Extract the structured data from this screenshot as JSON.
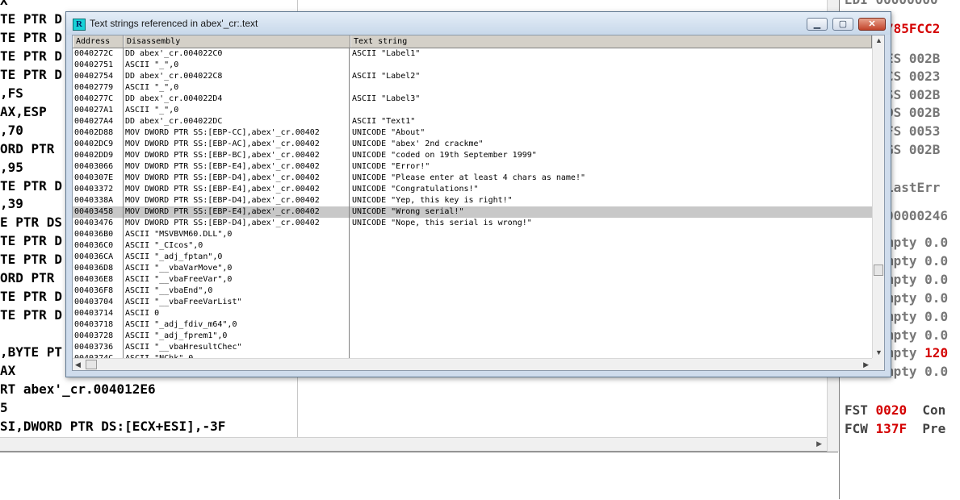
{
  "background": {
    "disasm_lines": [
      "X",
      "TE PTR D",
      "TE PTR D",
      "TE PTR D",
      "TE PTR D",
      ",FS",
      "AX,ESP",
      ",70",
      "ORD PTR",
      ",95",
      "TE PTR D",
      ",39",
      "E PTR DS",
      "TE PTR D",
      "TE PTR D",
      "ORD PTR",
      "TE PTR D",
      "TE PTR D",
      "",
      ",BYTE PT",
      "AX",
      "RT abex'_cr.004012E6",
      "5",
      "SI,DWORD PTR DS:[ECX+ESI],-3F"
    ],
    "registers": {
      "edi": "EDI 00000000",
      "eip_tail": "785FCC2",
      "es": "ES 002B",
      "cs": "CS 0023",
      "ss": "SS 002B",
      "ds": "DS 002B",
      "fs": "FS 0053",
      "gs": "GS 002B",
      "lasterr": "LastErr",
      "efl": "00000246",
      "fpu": [
        {
          "prefix": "mpty ",
          "value": "0.0",
          "red": false
        },
        {
          "prefix": "mpty ",
          "value": "0.0",
          "red": false
        },
        {
          "prefix": "mpty ",
          "value": "0.0",
          "red": false
        },
        {
          "prefix": "mpty ",
          "value": "0.0",
          "red": false
        },
        {
          "prefix": "mpty ",
          "value": "0.0",
          "red": false
        },
        {
          "prefix": "mpty ",
          "value": "0.0",
          "red": false
        },
        {
          "prefix": "mpty ",
          "value": "120",
          "red": true
        },
        {
          "prefix": "mpty ",
          "value": "0.0",
          "red": false
        }
      ],
      "fst_label": "FST",
      "fst_value": "0020",
      "fst_tail": "Con",
      "fcw_label": "FCW",
      "fcw_value": "137F",
      "fcw_tail": "Pre"
    }
  },
  "window": {
    "title": "Text strings referenced in abex'_cr:.text",
    "icon_letter": "R",
    "min_glyph": "▁",
    "max_glyph": "▢",
    "close_glyph": "✕",
    "columns": [
      "Address",
      "Disassembly",
      "Text string"
    ],
    "rows": [
      {
        "addr": "0040272C",
        "dis": "DD abex'_cr.004022C0",
        "text": "ASCII \"Label1\""
      },
      {
        "addr": "00402751",
        "dis": "ASCII \"_\",0",
        "text": ""
      },
      {
        "addr": "00402754",
        "dis": "DD abex'_cr.004022C8",
        "text": "ASCII \"Label2\""
      },
      {
        "addr": "00402779",
        "dis": "ASCII \"_\",0",
        "text": ""
      },
      {
        "addr": "0040277C",
        "dis": "DD abex'_cr.004022D4",
        "text": "ASCII \"Label3\""
      },
      {
        "addr": "004027A1",
        "dis": "ASCII \"_\",0",
        "text": ""
      },
      {
        "addr": "004027A4",
        "dis": "DD abex'_cr.004022DC",
        "text": "ASCII \"Text1\""
      },
      {
        "addr": "00402D88",
        "dis": "MOV DWORD PTR SS:[EBP-CC],abex'_cr.00402",
        "text": "UNICODE \"About\""
      },
      {
        "addr": "00402DC9",
        "dis": "MOV DWORD PTR SS:[EBP-AC],abex'_cr.00402",
        "text": "UNICODE \"abex' 2nd crackme\""
      },
      {
        "addr": "00402DD9",
        "dis": "MOV DWORD PTR SS:[EBP-BC],abex'_cr.00402",
        "text": "UNICODE \"coded on 19th September 1999\""
      },
      {
        "addr": "00403066",
        "dis": "MOV DWORD PTR SS:[EBP-E4],abex'_cr.00402",
        "text": "UNICODE \"Error!\""
      },
      {
        "addr": "0040307E",
        "dis": "MOV DWORD PTR SS:[EBP-D4],abex'_cr.00402",
        "text": "UNICODE \"Please enter at least 4 chars as name!\""
      },
      {
        "addr": "00403372",
        "dis": "MOV DWORD PTR SS:[EBP-E4],abex'_cr.00402",
        "text": "UNICODE \"Congratulations!\""
      },
      {
        "addr": "0040338A",
        "dis": "MOV DWORD PTR SS:[EBP-D4],abex'_cr.00402",
        "text": "UNICODE \"Yep, this key is right!\""
      },
      {
        "addr": "00403458",
        "dis": "MOV DWORD PTR SS:[EBP-E4],abex'_cr.00402",
        "text": "UNICODE \"Wrong serial!\""
      },
      {
        "addr": "00403476",
        "dis": "MOV DWORD PTR SS:[EBP-D4],abex'_cr.00402",
        "text": "UNICODE \"Nope, this serial is wrong!\""
      },
      {
        "addr": "004036B0",
        "dis": "ASCII \"MSVBVM60.DLL\",0",
        "text": ""
      },
      {
        "addr": "004036C0",
        "dis": "ASCII \"_CIcos\",0",
        "text": ""
      },
      {
        "addr": "004036CA",
        "dis": "ASCII \"_adj_fptan\",0",
        "text": ""
      },
      {
        "addr": "004036D8",
        "dis": "ASCII \"__vbaVarMove\",0",
        "text": ""
      },
      {
        "addr": "004036E8",
        "dis": "ASCII \"__vbaFreeVar\",0",
        "text": ""
      },
      {
        "addr": "004036F8",
        "dis": "ASCII \"__vbaEnd\",0",
        "text": ""
      },
      {
        "addr": "00403704",
        "dis": "ASCII \"__vbaFreeVarList\"",
        "text": ""
      },
      {
        "addr": "00403714",
        "dis": "ASCII 0",
        "text": ""
      },
      {
        "addr": "00403718",
        "dis": "ASCII \"_adj_fdiv_m64\",0",
        "text": ""
      },
      {
        "addr": "00403728",
        "dis": "ASCII \"_adj_fprem1\",0",
        "text": ""
      },
      {
        "addr": "00403736",
        "dis": "ASCII \"__vbaHresultChec\"",
        "text": ""
      },
      {
        "addr": "0040374C",
        "dis": "ASCII \"NChk\",0",
        "text": ""
      }
    ],
    "selected_index": 14
  },
  "scroll_glyphs": {
    "up": "▲",
    "down": "▼",
    "left": "◀",
    "right": "▶"
  }
}
